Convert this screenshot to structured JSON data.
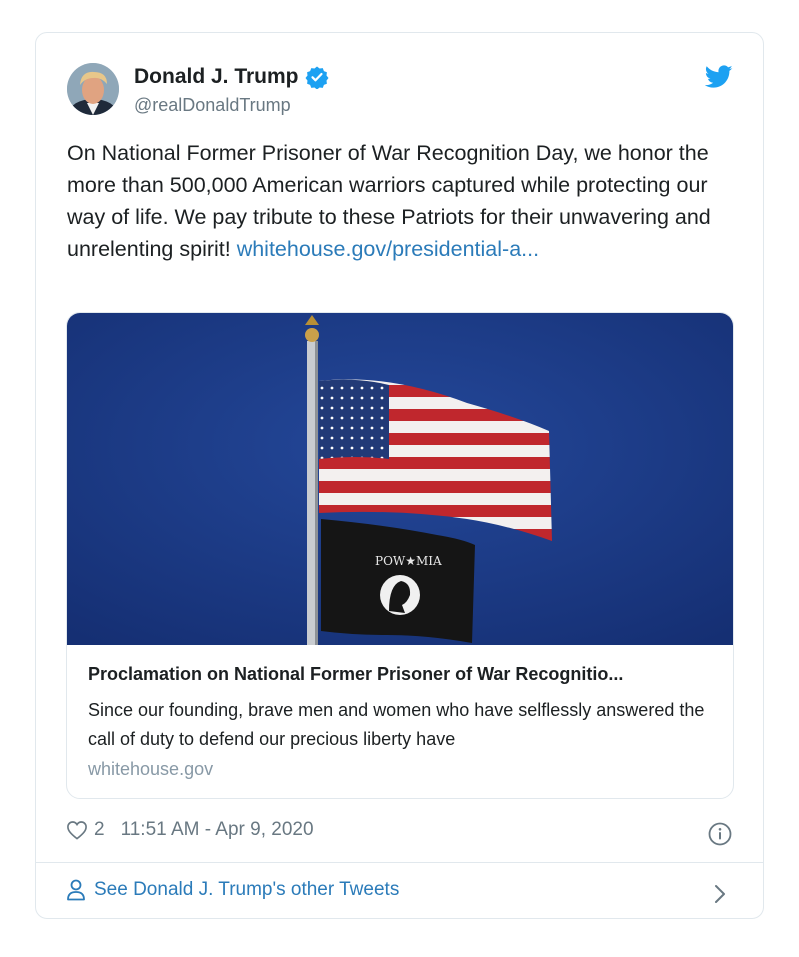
{
  "author": {
    "name": "Donald J. Trump",
    "handle": "@realDonaldTrump",
    "verified": true,
    "avatar_icon": "avatar-photo"
  },
  "tweet": {
    "text": "On National Former Prisoner of War Recognition Day, we honor the more than 500,000 American warriors captured while protecting our way of life. We pay tribute to these Patriots for their unwavering and unrelenting spirit! ",
    "link_text": "whitehouse.gov/presidential-a..."
  },
  "card": {
    "image_flag_text": "POW★MIA",
    "title": "Proclamation on National Former Prisoner of War Recognitio...",
    "description": "Since our founding, brave men and women who have selflessly answered the call of duty to defend our precious liberty have",
    "domain": "whitehouse.gov"
  },
  "meta": {
    "likes": "2",
    "timestamp": "11:51 AM - Apr 9, 2020"
  },
  "footer": {
    "label": "See Donald J. Trump's other Tweets"
  },
  "colors": {
    "link": "#2b7bb9",
    "verified": "#1da1f2",
    "muted": "#697882",
    "sky": "#1f3f8e"
  }
}
